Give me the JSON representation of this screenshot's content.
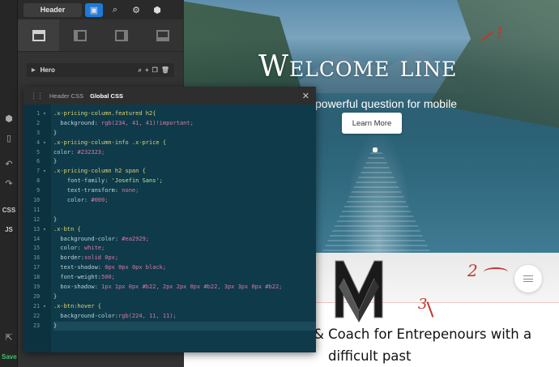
{
  "toolbar": {
    "header_label": "Header"
  },
  "sidebar": {
    "css_label": "CSS",
    "js_label": "JS",
    "save_label": "Save"
  },
  "hero_row": {
    "label": "Hero"
  },
  "editor": {
    "tabs": [
      "Header CSS",
      "Global CSS"
    ],
    "active_tab": "Global CSS",
    "line_numbers": [
      "1",
      "2",
      "3",
      "4",
      "5",
      "6",
      "7",
      "8",
      "9",
      "10",
      "11",
      "12",
      "13",
      "14",
      "15",
      "16",
      "17",
      "18",
      "19",
      "20",
      "21",
      "22",
      "23"
    ],
    "lines": [
      ".x-pricing-column.featured h2{",
      "  background: rgb(234, 41, 41)!important;",
      "}",
      ".x-pricing-column-info .x-price {",
      "color: #232323;",
      "}",
      ".x-pricing-column h2 span {",
      "    font-family: 'Josefin Sans';",
      "    text-transform: none;",
      "    color: #000;",
      "",
      "}",
      ".x-btn {",
      "  background-color: #ea2929;",
      "  color: white;",
      "  border:solid 0px;",
      "  text-shadow: 0px 0px 0px black;",
      "  font-weight:500;",
      "  box-shadow: 1px 1px 0px #b22, 2px 2px 0px #b22, 3px 3px 0px #b22;",
      "}",
      ".x-btn:hover {",
      "  background-color:rgb(224, 11, 11);",
      "}"
    ]
  },
  "preview": {
    "hero_title": "Welcome line",
    "hero_subtitle": "powerful question for mobile",
    "cta_label": "Learn More",
    "annotation_1": "1",
    "annotation_2": "2",
    "annotation_3": "3",
    "tagline_1": "& Coach for Entrepenours with a",
    "tagline_2": "difficult past"
  },
  "colors": {
    "accent_blue": "#1e7ad9",
    "save_green": "#3ec16a",
    "annotation_red": "#c0392b",
    "editor_bg": "#0f3a49"
  }
}
